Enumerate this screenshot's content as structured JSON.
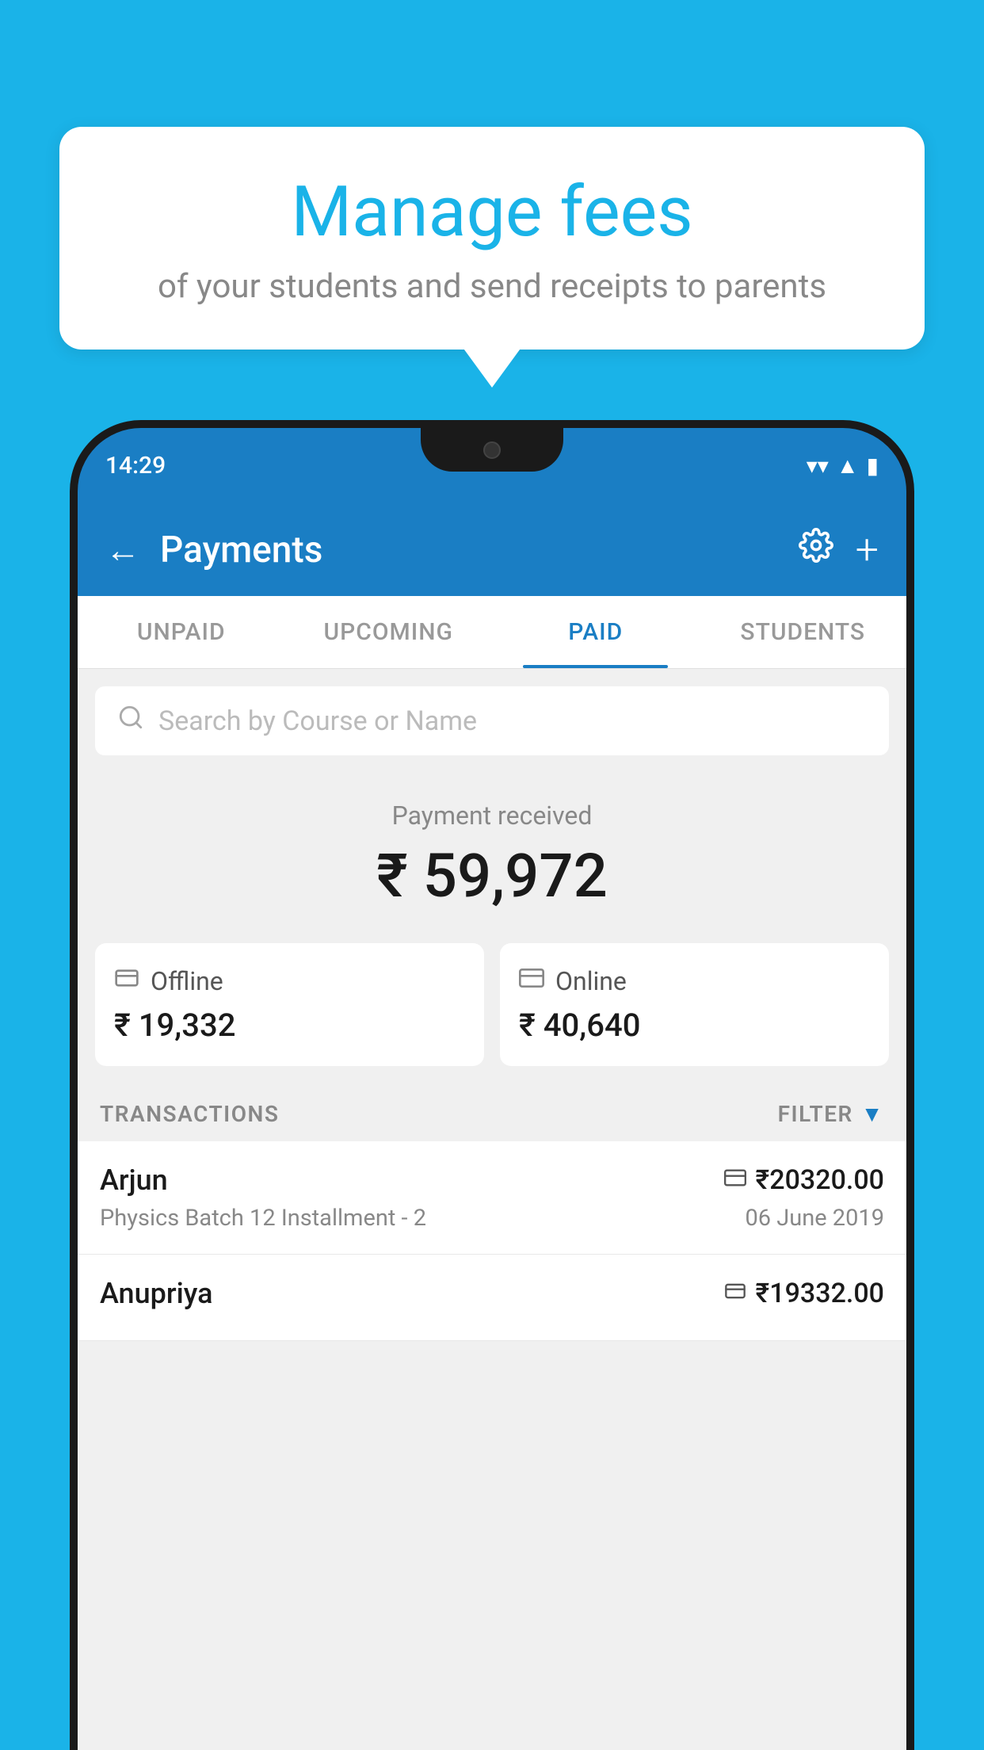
{
  "background_color": "#1ab3e8",
  "bubble": {
    "title": "Manage fees",
    "subtitle": "of your students and send receipts to parents"
  },
  "status_bar": {
    "time": "14:29",
    "icons": [
      "wifi",
      "signal",
      "battery"
    ]
  },
  "header": {
    "title": "Payments",
    "back_label": "←",
    "gear_label": "⚙",
    "plus_label": "+"
  },
  "tabs": [
    {
      "label": "UNPAID",
      "active": false
    },
    {
      "label": "UPCOMING",
      "active": false
    },
    {
      "label": "PAID",
      "active": true
    },
    {
      "label": "STUDENTS",
      "active": false
    }
  ],
  "search": {
    "placeholder": "Search by Course or Name"
  },
  "payment_received": {
    "label": "Payment received",
    "amount": "₹ 59,972"
  },
  "payment_cards": [
    {
      "type": "Offline",
      "amount": "₹ 19,332",
      "icon": "rupee-offline"
    },
    {
      "type": "Online",
      "amount": "₹ 40,640",
      "icon": "card-online"
    }
  ],
  "transactions_section": {
    "label": "TRANSACTIONS",
    "filter_label": "FILTER"
  },
  "transactions": [
    {
      "name": "Arjun",
      "course": "Physics Batch 12 Installment - 2",
      "amount": "₹20320.00",
      "date": "06 June 2019",
      "icon": "card"
    },
    {
      "name": "Anupriya",
      "course": "",
      "amount": "₹19332.00",
      "date": "",
      "icon": "rupee"
    }
  ]
}
